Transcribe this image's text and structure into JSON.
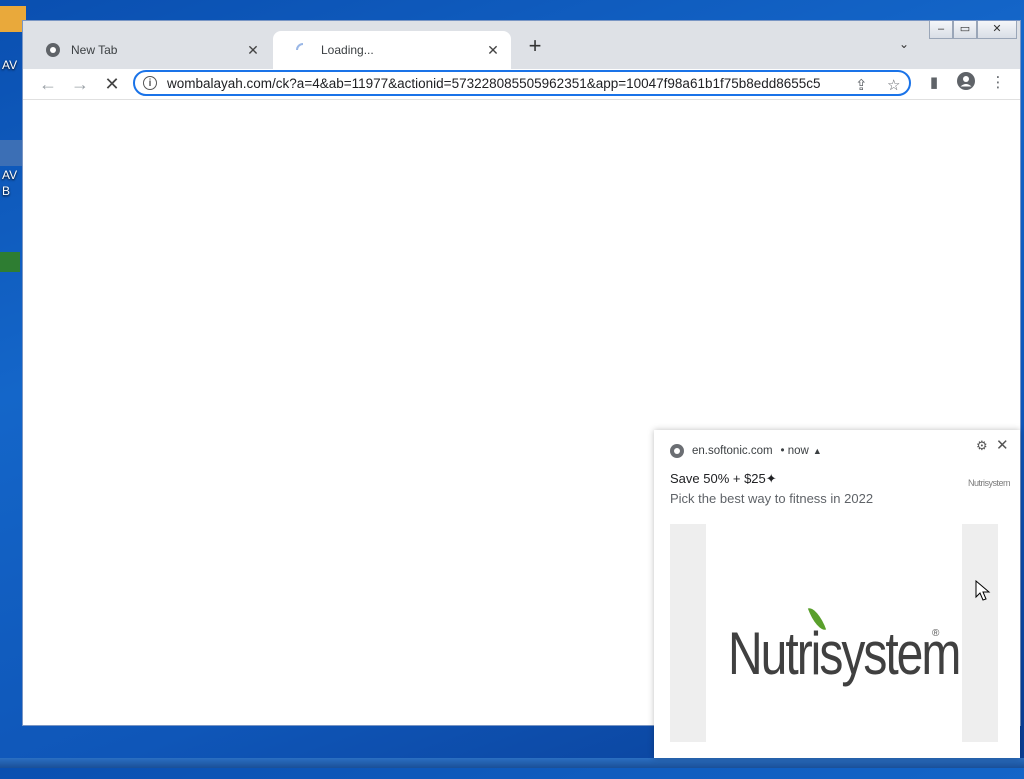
{
  "desktop": {
    "icon_labels": [
      "AV",
      "AV",
      "B"
    ]
  },
  "browser": {
    "tabs": [
      {
        "label": "New Tab",
        "active": false
      },
      {
        "label": "Loading...",
        "active": true
      }
    ],
    "url": "wombalayah.com/ck?a=4&ab=11977&actionid=573228085505962351&app=10047f98a61b1f75b8edd8655c5"
  },
  "notification": {
    "source": "en.softonic.com",
    "time": "• now",
    "title": "Save 50% + $25",
    "body": "Pick the best way to fitness in 2022",
    "small_logo": "Nutrisystem",
    "brand": "Nutrisystem"
  }
}
